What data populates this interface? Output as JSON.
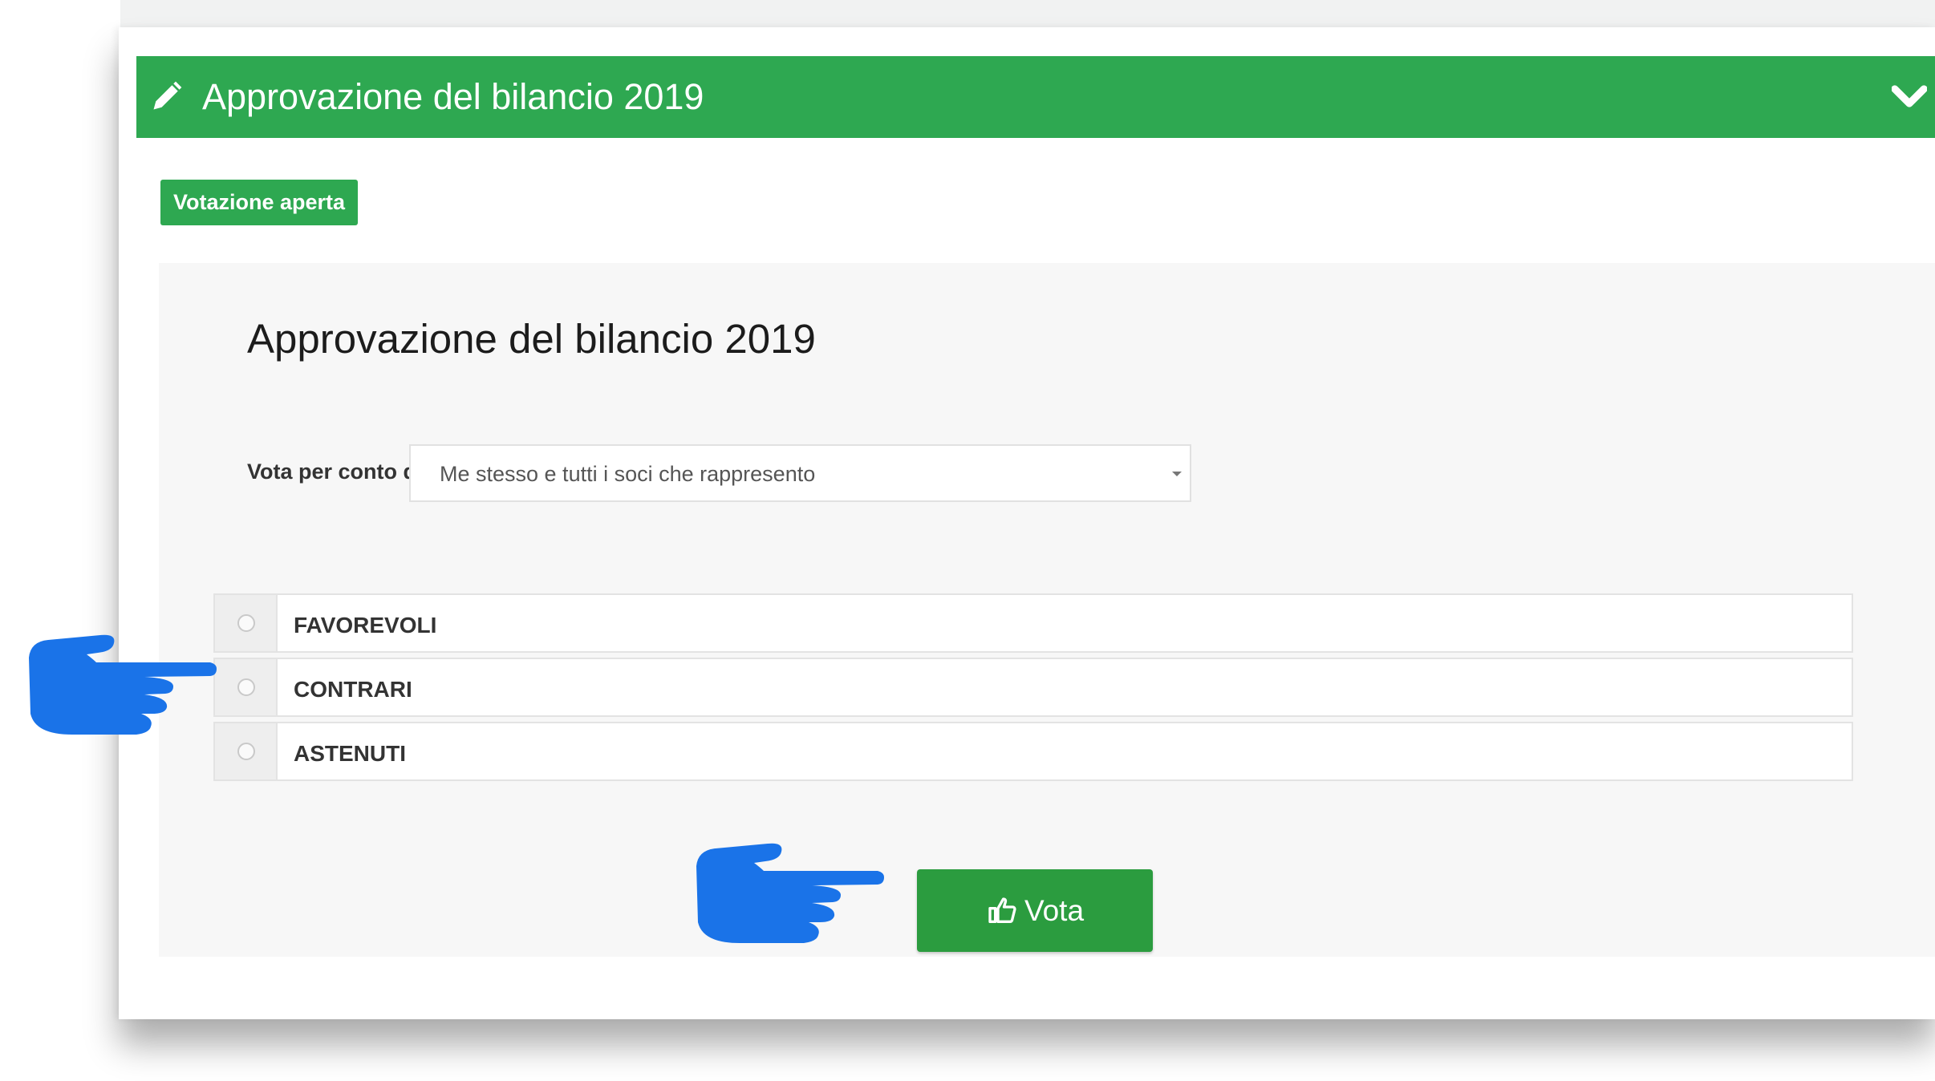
{
  "header": {
    "title": "Approvazione del bilancio 2019",
    "icon": "pencil-icon",
    "collapse_icon": "chevron-down-icon",
    "color": "#2ea851"
  },
  "status": {
    "badge": "Votazione aperta"
  },
  "vote": {
    "question": "Approvazione del bilancio 2019",
    "delegate_label": "Vota per conto di:",
    "delegate_value": "Me stesso e tutti i soci che rappresento",
    "options": [
      {
        "label": "FAVOREVOLI"
      },
      {
        "label": "CONTRARI"
      },
      {
        "label": "ASTENUTI"
      }
    ],
    "submit_label": "Vota",
    "submit_icon": "thumbs-up-icon"
  },
  "annotations": {
    "pointer_color": "#1a73e8",
    "pointer_icon": "hand-pointer-icon"
  }
}
